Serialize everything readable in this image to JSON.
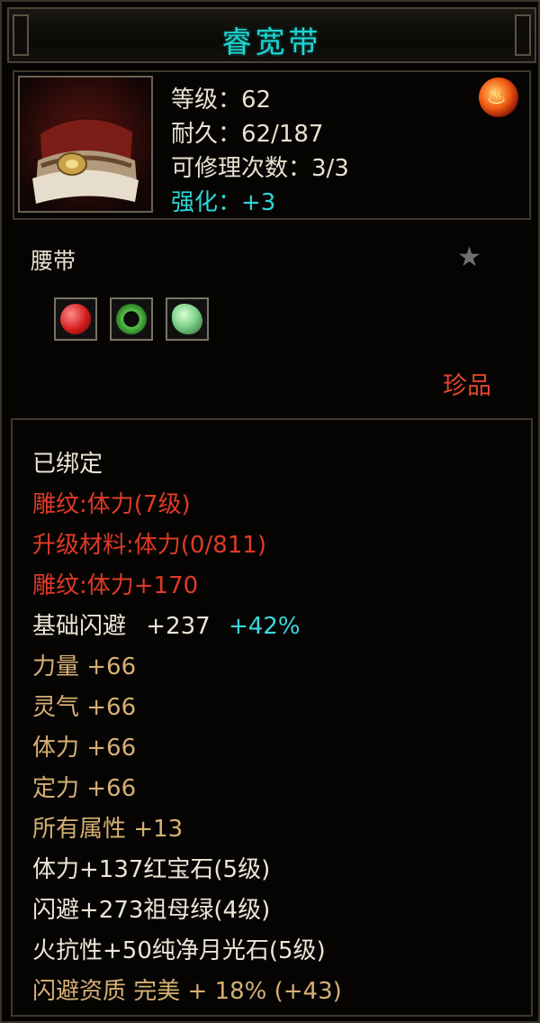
{
  "item": {
    "name": "睿宽带",
    "stats": [
      {
        "text": "等级：62",
        "tone": "white"
      },
      {
        "text": "耐久：62/187",
        "tone": "white"
      },
      {
        "text": "可修理次数：3/3",
        "tone": "white"
      },
      {
        "text": "强化：+3",
        "tone": "cyan"
      }
    ],
    "type": "腰带",
    "rarity": "珍品",
    "icons": {
      "item": "waist-belt-icon",
      "emblem": "dragon-emblem-icon",
      "star": "star-icon",
      "gems": [
        "ruby-gem-icon",
        "emerald-ring-icon",
        "moonstone-gem-icon"
      ]
    }
  },
  "attributes": {
    "bound": "已绑定",
    "engrave_level": "雕纹:体力(7级)",
    "upgrade_material": "升级材料:体力(0/811)",
    "engrave_bonus": "雕纹:体力+170",
    "base_dodge_label": "基础闪避",
    "base_dodge_value": "+237",
    "base_dodge_percent": "+42%",
    "strength": "力量  +66",
    "spirit": "灵气  +66",
    "stamina": "体力  +66",
    "focus": "定力  +66",
    "all_attrs": "所有属性  +13",
    "gem1": "体力+137红宝石(5级)",
    "gem2": "闪避+273祖母绿(4级)",
    "gem3": "火抗性+50纯净月光石(5级)",
    "dodge_quality": "闪避资质  完美  + 18% (+43)"
  },
  "colors": {
    "title": "#1fd4d0",
    "stat_text": "#e8e2d0",
    "enhance": "#2ed6d8",
    "engrave_red": "#e03a26",
    "attr_gold": "#d7b074",
    "percent_cyan": "#3cd8dc",
    "rarity": "#e2462a"
  }
}
